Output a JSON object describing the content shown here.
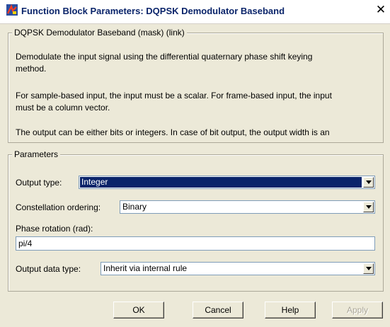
{
  "window": {
    "title": "Function Block Parameters: DQPSK Demodulator Baseband",
    "close_glyph": "✕",
    "icon": "simulink-block-icon"
  },
  "description": {
    "legend": "DQPSK Demodulator Baseband (mask) (link)",
    "line1a": "Demodulate the input signal using the differential quaternary phase shift keying",
    "line1b": "method.",
    "line2a": "For sample-based input, the input must be a scalar. For frame-based input, the input",
    "line2b": "must be a column vector.",
    "line3": "The output can be either bits or integers. In case of bit output, the output width is an"
  },
  "parameters": {
    "legend": "Parameters",
    "output_type": {
      "label": "Output type:",
      "value": "Integer"
    },
    "constellation_ordering": {
      "label": "Constellation ordering:",
      "value": "Binary"
    },
    "phase_rotation": {
      "label": "Phase rotation (rad):",
      "value": "pi/4"
    },
    "output_data_type": {
      "label": "Output data type:",
      "value": "Inherit via internal rule"
    }
  },
  "buttons": {
    "ok": "OK",
    "cancel": "Cancel",
    "help": "Help",
    "apply": "Apply"
  },
  "colors": {
    "title_text": "#0a246a",
    "selection": "#0a246a",
    "dialog_bg": "#ece9d8"
  }
}
